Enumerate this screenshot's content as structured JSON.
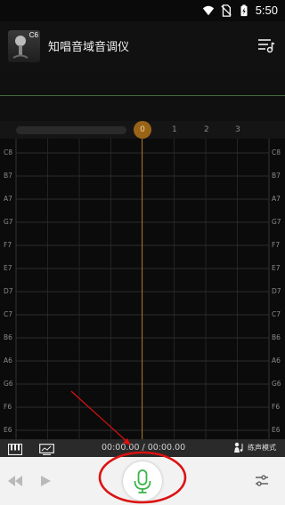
{
  "status_bar": {
    "time": "5:50",
    "icons": [
      "wifi-icon",
      "no-sim-icon",
      "battery-icon"
    ]
  },
  "header": {
    "logo_text": "C6",
    "title": "知唱音域音调仪",
    "menu_icon": "music-list-icon"
  },
  "timeline": {
    "playhead": "0",
    "ticks": [
      "1",
      "2",
      "3"
    ]
  },
  "grid": {
    "notes": [
      "C8",
      "B7",
      "A7",
      "G7",
      "F7",
      "E7",
      "D7",
      "C7",
      "B6",
      "A6",
      "G6",
      "F6",
      "E6"
    ]
  },
  "toolbar": {
    "icons": [
      "piano-keyboard-icon",
      "screen-icon"
    ],
    "time_display": "00:00.00 / 00:00.00",
    "practice_mode_label": "练声模式",
    "practice_mode_icon": "singer-icon"
  },
  "bottom_controls": {
    "icons": [
      "rewind-icon",
      "play-icon",
      "microphone-icon",
      "equalizer-settings-icon"
    ]
  },
  "colors": {
    "playhead": "#a8701e",
    "pitch_line": "#3e6a3e",
    "annotation": "#dd1111",
    "mic": "#3cb44a"
  }
}
